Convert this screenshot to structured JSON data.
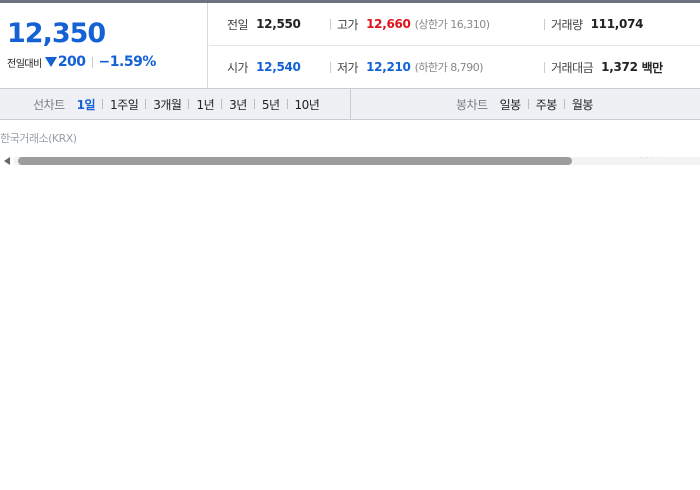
{
  "summary": {
    "price": "12,350",
    "change_label": "전일대비",
    "change_amount": "200",
    "change_percent": "−1.59%",
    "prev_close_label": "전일",
    "prev_close": "12,550",
    "high_label": "고가",
    "high": "12,660",
    "upper_limit": "(상한가 16,310)",
    "volume_label": "거래량",
    "volume": "111,074",
    "open_label": "시가",
    "open": "12,540",
    "low_label": "저가",
    "low": "12,210",
    "lower_limit": "(하한가 8,790)",
    "value_label": "거래대금",
    "value": "1,372",
    "value_unit": "백만"
  },
  "tabs": {
    "line_chart_label": "선차트",
    "line_periods": [
      "1일",
      "1주일",
      "3개월",
      "1년",
      "3년",
      "5년",
      "10년"
    ],
    "active_period": "1일",
    "candle_chart_label": "봉차트",
    "candle_periods": [
      "일봉",
      "주봉",
      "월봉"
    ]
  },
  "chart": {
    "exchange": "한국거래소(KRX)",
    "scroll_tick": "· · · ·"
  },
  "colors": {
    "down": "#1461d6",
    "up": "#e0121a",
    "tab_bar_bg": "#eef0f4"
  },
  "icons": {
    "change_direction": "down-triangle-icon",
    "scroll_left": "arrow-left-icon"
  }
}
